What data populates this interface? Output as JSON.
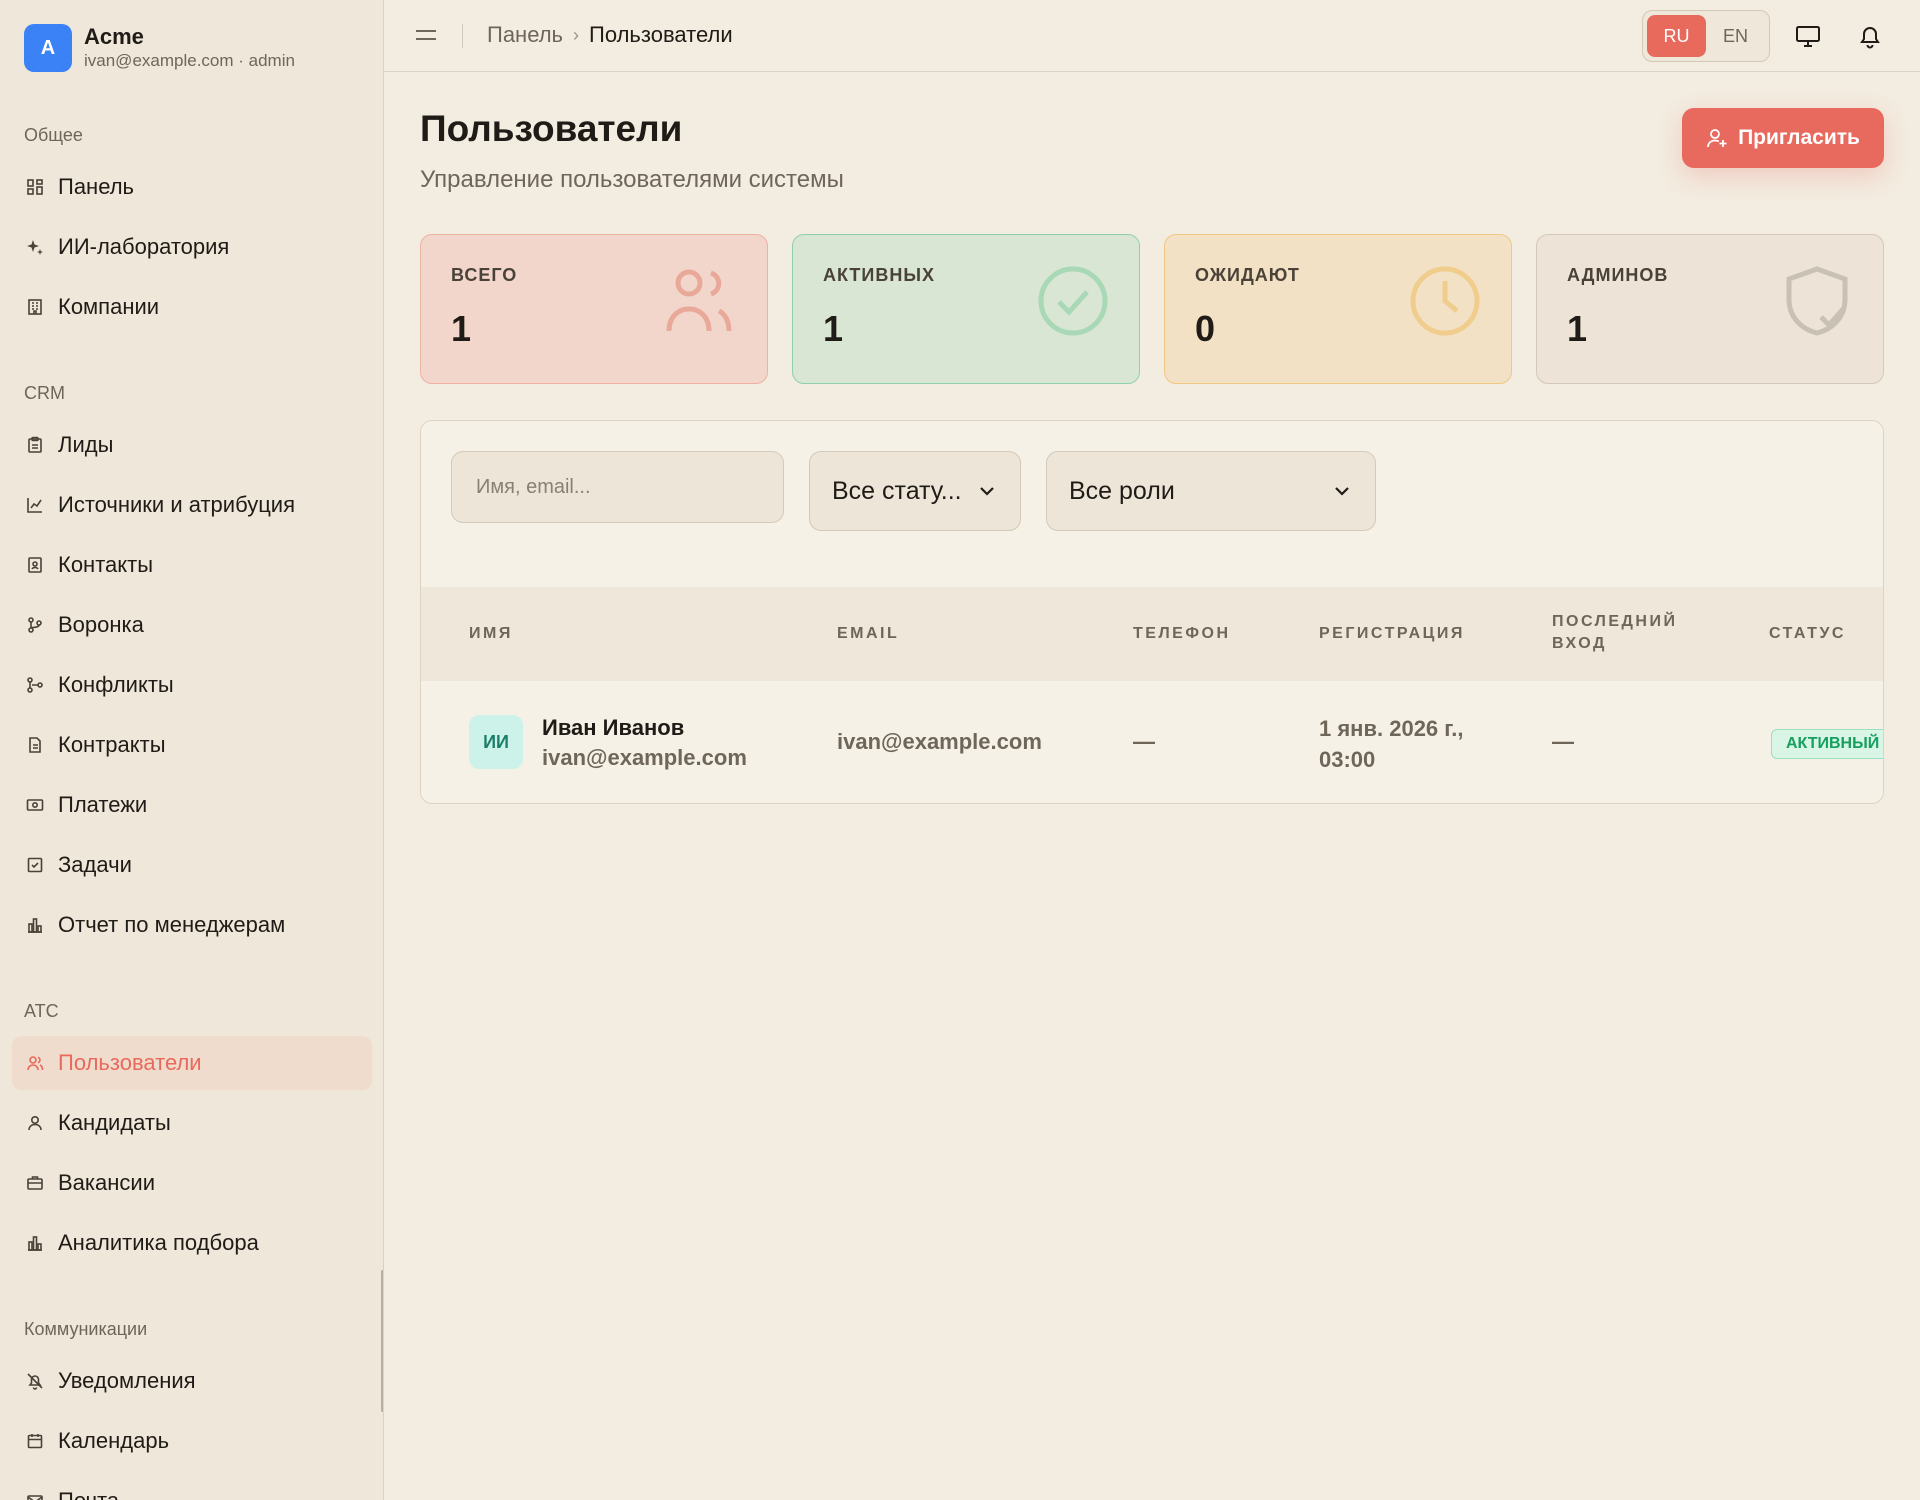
{
  "brand": {
    "initial": "A",
    "name": "Acme",
    "subtitle": "ivan@example.com · admin"
  },
  "sidebar": {
    "sections": [
      {
        "title": "Общее",
        "items": [
          {
            "label": "Панель",
            "icon": "dashboard-icon"
          },
          {
            "label": "ИИ-лаборатория",
            "icon": "sparkles-icon"
          },
          {
            "label": "Компании",
            "icon": "building-icon"
          }
        ]
      },
      {
        "title": "CRM",
        "items": [
          {
            "label": "Лиды",
            "icon": "clipboard-icon"
          },
          {
            "label": "Источники и атрибуция",
            "icon": "chart-icon"
          },
          {
            "label": "Контакты",
            "icon": "contact-icon"
          },
          {
            "label": "Воронка",
            "icon": "funnel-icon"
          },
          {
            "label": "Конфликты",
            "icon": "git-branch-icon"
          },
          {
            "label": "Контракты",
            "icon": "document-icon"
          },
          {
            "label": "Платежи",
            "icon": "banknote-icon"
          },
          {
            "label": "Задачи",
            "icon": "checkbox-icon"
          },
          {
            "label": "Отчет по менеджерам",
            "icon": "bar-chart-icon"
          }
        ]
      },
      {
        "title": "ATC",
        "items": [
          {
            "label": "Пользователи",
            "icon": "users-icon",
            "active": true
          },
          {
            "label": "Кандидаты",
            "icon": "user-icon"
          },
          {
            "label": "Вакансии",
            "icon": "briefcase-icon"
          },
          {
            "label": "Аналитика подбора",
            "icon": "bar-chart-icon"
          }
        ]
      },
      {
        "title": "Коммуникации",
        "items": [
          {
            "label": "Уведомления",
            "icon": "bell-off-icon"
          },
          {
            "label": "Календарь",
            "icon": "calendar-icon"
          },
          {
            "label": "Почта",
            "icon": "mail-icon"
          }
        ]
      }
    ]
  },
  "header": {
    "breadcrumb_root": "Панель",
    "breadcrumb_sep": "›",
    "breadcrumb_current": "Пользователи",
    "lang_ru": "RU",
    "lang_en": "EN"
  },
  "page": {
    "title": "Пользователи",
    "subtitle": "Управление пользователями системы",
    "invite_label": "Пригласить"
  },
  "stats": [
    {
      "label": "ВСЕГО",
      "value": "1",
      "icon": "users-icon",
      "bg": "#f2d6cb",
      "border": "#eeb0a2",
      "icon_color": "#e9a999"
    },
    {
      "label": "АКТИВНЫХ",
      "value": "1",
      "icon": "check-circle-icon",
      "bg": "#d9e6d3",
      "border": "#8fd0a7",
      "icon_color": "#a8d8b6"
    },
    {
      "label": "ОЖИДАЮТ",
      "value": "0",
      "icon": "clock-icon",
      "bg": "#f2e1c4",
      "border": "#f0c884",
      "icon_color": "#f0cd8c"
    },
    {
      "label": "АДМИНОВ",
      "value": "1",
      "icon": "shield-check-icon",
      "bg": "#ede4d7",
      "border": "#d4c9b8",
      "icon_color": "#c9c1b4"
    }
  ],
  "filters": {
    "search_placeholder": "Имя, email...",
    "status_value": "Все стату...",
    "role_value": "Все роли"
  },
  "table": {
    "columns": [
      "ИМЯ",
      "EMAIL",
      "ТЕЛЕФОН",
      "РЕГИСТРАЦИЯ",
      "ПОСЛЕДНИЙ ВХОД",
      "СТАТУС"
    ],
    "rows": [
      {
        "initials": "ИИ",
        "name": "Иван Иванов",
        "name_email": "ivan@example.com",
        "email": "ivan@example.com",
        "phone": "—",
        "registered": "1 янв. 2026 г., 03:00",
        "last_login": "—",
        "status": "АКТИВНЫЙ"
      }
    ]
  },
  "colors": {
    "accent": "#e8695d",
    "sidebar_bg": "#efe7da",
    "page_bg": "#f3ece0"
  }
}
